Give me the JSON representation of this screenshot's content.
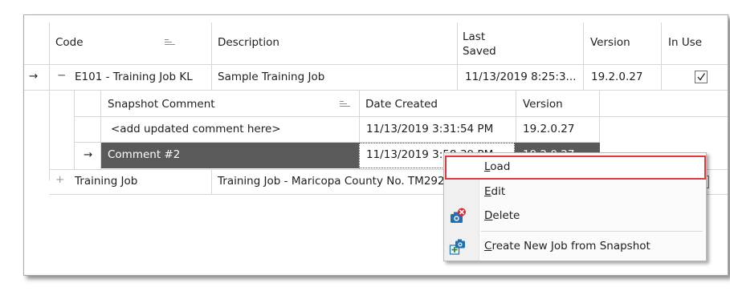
{
  "grid": {
    "headers": {
      "code": "Code",
      "description": "Description",
      "last_saved_line1": "Last",
      "last_saved_line2": "Saved",
      "version": "Version",
      "in_use": "In Use"
    },
    "rows": [
      {
        "indicator": "→",
        "expander": "−",
        "code": "E101 - Training Job KL",
        "description": "Sample Training Job",
        "last_saved": "11/13/2019 8:25:3...",
        "version": "19.2.0.27",
        "in_use": true
      },
      {
        "expander": "+",
        "code": "Training Job",
        "description": "Training Job - Maricopa County No. TM292"
      }
    ],
    "detail": {
      "headers": {
        "comment": "Snapshot Comment",
        "date_created": "Date Created",
        "version": "Version"
      },
      "rows": [
        {
          "comment": "<add updated comment here>",
          "date_created": "11/13/2019 3:31:54 PM",
          "version": "19.2.0.27"
        },
        {
          "indicator": "→",
          "comment": "Comment #2",
          "date_created": "11/13/2019 3:58:39 PM",
          "version": "19.2.0.27"
        }
      ]
    }
  },
  "context_menu": {
    "items": [
      {
        "accel": "L",
        "rest": "oad",
        "icon": "",
        "highlighted": true
      },
      {
        "accel": "E",
        "rest": "dit",
        "icon": ""
      },
      {
        "accel": "D",
        "rest": "elete",
        "icon": "camera-delete-icon"
      },
      {
        "accel": "C",
        "rest": "reate New Job from Snapshot",
        "icon": "camera-new-job-icon"
      }
    ]
  },
  "colors": {
    "selected_row": "#5a5a5a",
    "highlight_border": "#e03a3e",
    "grid_line": "#d6d6d6",
    "delete_badge": "#d9282f",
    "icon_blue": "#1f6fb2"
  }
}
